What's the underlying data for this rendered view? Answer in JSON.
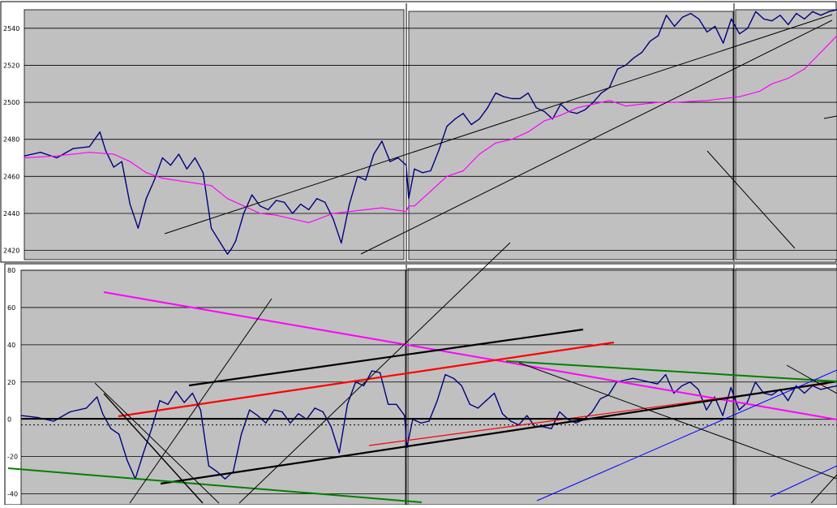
{
  "colors": {
    "plot_bg": "#c0c0c0",
    "price": "#000080",
    "ma": "#ff00ff",
    "grid": "#000000",
    "red": "#ff0000",
    "green": "#008000",
    "blue": "#0000ff",
    "black": "#000000"
  },
  "chart_data": [
    {
      "type": "line",
      "panel": "top",
      "ylim": [
        2415,
        2550
      ],
      "yticks": [
        2420,
        2440,
        2460,
        2480,
        2500,
        2520,
        2540
      ],
      "ytick_labels": [
        "2420",
        "2440",
        "2460",
        "2480",
        "2500",
        "2520",
        "2540"
      ],
      "grid": true,
      "xlim": [
        0,
        1000
      ],
      "series": [
        {
          "role": "price",
          "x": [
            0,
            20,
            40,
            60,
            80,
            93,
            100,
            110,
            120,
            130,
            140,
            150,
            160,
            170,
            180,
            190,
            200,
            210,
            220,
            230,
            240,
            250,
            255,
            260,
            270,
            280,
            290,
            300,
            310,
            320,
            330,
            340,
            350,
            360,
            370,
            380,
            390,
            400,
            410,
            420,
            430,
            440,
            450,
            460,
            470,
            473,
            480,
            490,
            500,
            510,
            520,
            530,
            540,
            550,
            560,
            570,
            580,
            590,
            600,
            610,
            620,
            630,
            640,
            650,
            660,
            670,
            680,
            690,
            700,
            710,
            720,
            730,
            740,
            750,
            760,
            770,
            780,
            790,
            800,
            810,
            820,
            830,
            840,
            850,
            860,
            870,
            880,
            890,
            900,
            910,
            920,
            930,
            940,
            950,
            960,
            970,
            980,
            990,
            1000
          ],
          "y": [
            2471,
            2473,
            2470,
            2475,
            2476,
            2484,
            2474,
            2465,
            2468,
            2445,
            2432,
            2448,
            2458,
            2470,
            2466,
            2472,
            2464,
            2470,
            2462,
            2432,
            2425,
            2418,
            2421,
            2425,
            2440,
            2450,
            2444,
            2442,
            2447,
            2446,
            2440,
            2445,
            2442,
            2448,
            2446,
            2437,
            2424,
            2445,
            2460,
            2458,
            2472,
            2479,
            2468,
            2470,
            2466,
            2448,
            2464,
            2462,
            2463,
            2474,
            2487,
            2491,
            2494,
            2488,
            2491,
            2497,
            2505,
            2503,
            2502,
            2502,
            2505,
            2497,
            2495,
            2491,
            2499,
            2495,
            2494,
            2496,
            2500,
            2505,
            2508,
            2518,
            2520,
            2524,
            2527,
            2533,
            2536,
            2547,
            2541,
            2546,
            2548,
            2545,
            2538,
            2541,
            2532,
            2545,
            2537,
            2540,
            2549,
            2545,
            2544,
            2547,
            2542,
            2548,
            2545,
            2549,
            2547,
            2549,
            2550
          ]
        },
        {
          "role": "moving-average",
          "x": [
            0,
            40,
            80,
            110,
            130,
            150,
            170,
            200,
            230,
            250,
            270,
            290,
            310,
            330,
            350,
            380,
            400,
            420,
            440,
            470,
            473,
            480,
            500,
            520,
            540,
            560,
            580,
            600,
            620,
            640,
            660,
            680,
            700,
            720,
            740,
            760,
            780,
            800,
            840,
            880,
            905,
            920,
            940,
            960,
            980,
            1000
          ],
          "y": [
            2470,
            2471,
            2473,
            2472,
            2468,
            2462,
            2459,
            2457,
            2455,
            2448,
            2444,
            2440,
            2439,
            2437,
            2435,
            2440,
            2441,
            2442,
            2443,
            2441,
            2444,
            2444,
            2452,
            2460,
            2463,
            2472,
            2478,
            2480,
            2484,
            2490,
            2493,
            2497,
            2499,
            2501,
            2498,
            2499,
            2500,
            2500,
            2501,
            2503,
            2506,
            2510,
            2513,
            2518,
            2527,
            2536
          ]
        }
      ]
    },
    {
      "type": "line",
      "panel": "bottom",
      "ylim": [
        -45,
        80
      ],
      "yticks": [
        -40,
        -20,
        0,
        20,
        40,
        60,
        80
      ],
      "ytick_labels": [
        "-40",
        "-20",
        "0",
        "20",
        "40",
        "60",
        "80"
      ],
      "grid": true,
      "xlim": [
        0,
        1000
      ],
      "series": [
        {
          "role": "oscillator",
          "x": [
            0,
            20,
            40,
            60,
            80,
            93,
            100,
            110,
            120,
            130,
            140,
            150,
            160,
            170,
            180,
            190,
            200,
            210,
            220,
            230,
            240,
            250,
            255,
            260,
            270,
            280,
            290,
            300,
            310,
            320,
            330,
            340,
            350,
            360,
            370,
            380,
            390,
            400,
            410,
            420,
            430,
            440,
            450,
            460,
            470,
            473,
            480,
            490,
            500,
            510,
            520,
            530,
            540,
            550,
            560,
            570,
            580,
            590,
            600,
            610,
            620,
            630,
            640,
            650,
            660,
            670,
            680,
            690,
            700,
            710,
            720,
            730,
            740,
            750,
            760,
            770,
            780,
            790,
            800,
            810,
            820,
            830,
            840,
            850,
            860,
            870,
            880,
            890,
            900,
            910,
            920,
            930,
            940,
            950,
            960,
            970,
            980,
            990,
            1000
          ],
          "y": [
            2,
            1,
            -1,
            4,
            6,
            12,
            3,
            -5,
            -8,
            -22,
            -32,
            -18,
            -5,
            10,
            8,
            15,
            9,
            14,
            5,
            -25,
            -28,
            -32,
            -30,
            -28,
            -8,
            5,
            2,
            -2,
            5,
            4,
            -2,
            3,
            0,
            6,
            4,
            -4,
            -18,
            8,
            20,
            18,
            26,
            25,
            8,
            8,
            2,
            -15,
            0,
            -2,
            -1,
            10,
            24,
            22,
            18,
            8,
            6,
            10,
            14,
            3,
            -1,
            -3,
            2,
            -4,
            -4,
            -5,
            4,
            0,
            -2,
            0,
            4,
            11,
            13,
            20,
            21,
            22,
            21,
            20,
            19,
            24,
            14,
            18,
            20,
            16,
            5,
            12,
            2,
            17,
            5,
            9,
            20,
            14,
            13,
            16,
            10,
            18,
            14,
            18,
            16,
            17,
            18
          ]
        }
      ]
    }
  ]
}
